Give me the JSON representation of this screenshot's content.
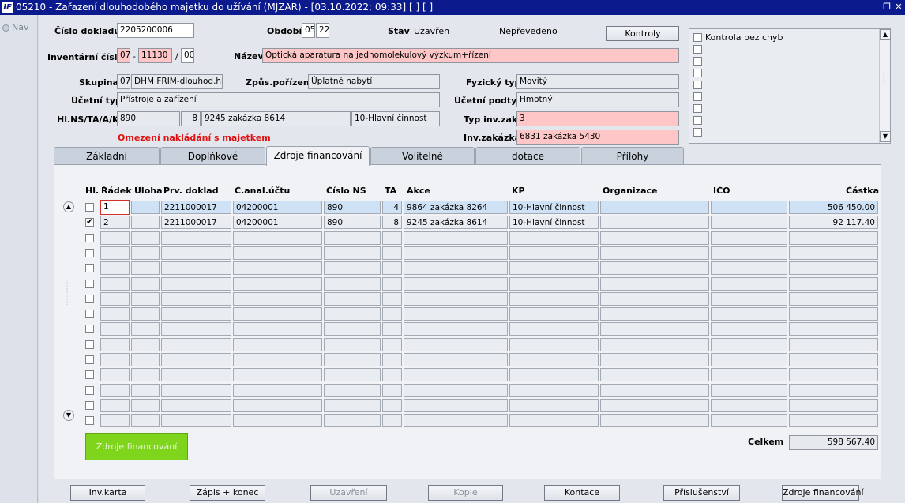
{
  "window": {
    "title": "05210 - Zařazení dlouhodobého majetku do užívání (MJZAR) - [03.10.2022; 09:33]  [ ]  [ ]",
    "icon_text": "IF"
  },
  "nav": {
    "label": "Nav"
  },
  "header": {
    "cislo_dokladu_label": "Číslo dokladu",
    "cislo_dokladu": "2205200006",
    "obdobi_label": "Období",
    "obdobi_1": "05",
    "obdobi_2": "22",
    "stav_label": "Stav",
    "stav": "Uzavřen",
    "neprevedeno": "Nepřevedeno",
    "kontroly_button": "Kontroly",
    "inventarni_cislo_label": "Inventární číslo",
    "inv_1": "07",
    "inv_2": "11130",
    "inv_3": "00",
    "nazev_label": "Název",
    "nazev": "Optická aparatura na jednomolekulový výzkum+řízení",
    "skupina_label": "Skupina",
    "skupina_code": "07",
    "skupina": "DHM FRIM-dlouhod.hmo",
    "zpusob_label": "Způs.pořízení",
    "zpusob": "Úplatné nabytí",
    "fyzicky_typ_label": "Fyzický typ",
    "fyzicky_typ": "Movitý",
    "ucetni_typ_label": "Účetní typ",
    "ucetni_typ": "Přístroje a zařízení",
    "ucetni_podtyp_label": "Účetní podtyp",
    "ucetni_podtyp": "Hmotný",
    "hlns_label": "Hl.NS/TA/A/KP",
    "hlns_ns": "890",
    "hlns_ta": "8",
    "hlns_akce": "9245 zakázka 8614",
    "hlns_kp": "10-Hlavní činnost",
    "typ_inv_label": "Typ inv.zak.",
    "typ_inv": "3",
    "omezeni": "Omezení nakládání s majetkem",
    "inv_zakazka_label": "Inv.zakázka",
    "inv_zakazka": "6831 zakázka 5430"
  },
  "checks": {
    "first_label": "Kontrola bez chyb"
  },
  "tabs": [
    "Základní",
    "Doplňkové",
    "Zdroje financování",
    "Volitelné",
    "dotace",
    "Přílohy"
  ],
  "active_tab": 2,
  "table": {
    "headers": [
      "Hl.",
      "Řádek",
      "Úloha",
      "Prv. doklad",
      "Č.anal.účtu",
      "Číslo NS",
      "TA",
      "Akce",
      "KP",
      "Organizace",
      "IČO",
      "Částka"
    ],
    "rows": [
      {
        "hl": false,
        "radek": "1",
        "uloha": "",
        "prv_doklad": "2211000017",
        "anal": "04200001",
        "ns": "890",
        "ta": "4",
        "akce": "9864 zakázka 8264",
        "kp": "10-Hlavní činnost",
        "organizace": "",
        "ico": "",
        "castka": "506 450.00"
      },
      {
        "hl": true,
        "radek": "2",
        "uloha": "",
        "prv_doklad": "2211000017",
        "anal": "04200001",
        "ns": "890",
        "ta": "8",
        "akce": "9245 zakázka 8614",
        "kp": "10-Hlavní činnost",
        "organizace": "",
        "ico": "",
        "castka": "92 117.40"
      }
    ],
    "empty_rows": 13
  },
  "green_button": "Zdroje financování",
  "celkem_label": "Celkem",
  "celkem": "598 567.40",
  "bottom_buttons": [
    "Inv.karta",
    "Zápis + konec",
    "Uzavření",
    "Kopie",
    "Kontace",
    "Příslušenství",
    "Zdroje financování"
  ],
  "colors": {
    "titlebar": "#0b1a8c",
    "pink_field": "#fec6c6",
    "selected_row": "#cfe1f4",
    "warning": "#e01010",
    "green_button": "#7fd41c"
  }
}
